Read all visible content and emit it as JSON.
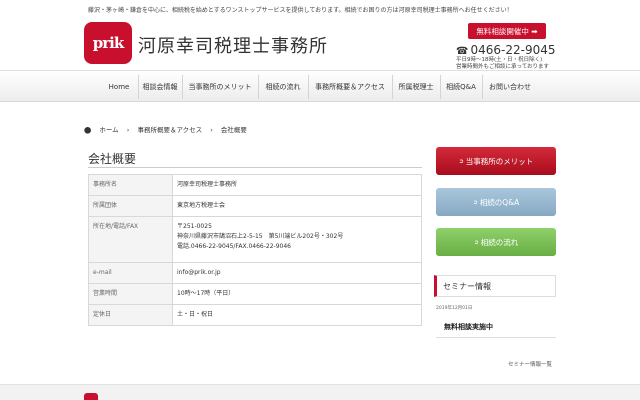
{
  "header": {
    "tagline": "藤沢・茅ヶ崎・鎌倉を中心に、相続税を始めとするワンストップサービスを提供しております。相続でお困りの方は河原幸司税理士事務所へお任せください！",
    "logo_text": "prik",
    "office_name": "河原幸司税理士事務所",
    "consult_button": "無料相談開催中 ➡",
    "phone": "0466-22-9045",
    "hours_line1": "平日9時〜18時(土・日・祝日除く)",
    "hours_line2": "営業時間外もご相談に承っております"
  },
  "nav": {
    "items": [
      {
        "label": "Home"
      },
      {
        "label": "相談会情報"
      },
      {
        "label": "当事務所のメリット"
      },
      {
        "label": "相続の流れ"
      },
      {
        "label": "事務所概要＆アクセス"
      },
      {
        "label": "所属税理士"
      },
      {
        "label": "相続Q&A"
      },
      {
        "label": "お問い合わせ"
      }
    ]
  },
  "breadcrumb": {
    "home": "ホーム",
    "section": "事務所概要＆アクセス",
    "current": "会社概要"
  },
  "main": {
    "title": "会社概要",
    "rows": [
      {
        "label": "事務所名",
        "value": "河原幸司税理士事務所"
      },
      {
        "label": "所属団体",
        "value": "東京地方税理士会"
      },
      {
        "label": "所在地/電話/FAX",
        "lines": [
          "〒251-0025",
          "神奈川県藤沢市鵠沼石上2-5-15　第5川端ビル202号・302号",
          "電話.0466-22-9045/FAX.0466-22-9046"
        ]
      },
      {
        "label": "e-mail",
        "value": "info@prik.or.jp"
      },
      {
        "label": "営業時間",
        "value": "10時〜17時（平日）"
      },
      {
        "label": "定休日",
        "value": "土・日・祝日"
      }
    ]
  },
  "sidebar": {
    "merit_button": "当事務所のメリット",
    "qa_button": "相続のQ&A",
    "flow_button": "相続の流れ",
    "seminar_heading": "セミナー情報",
    "seminar_date": "2019年12月01日",
    "seminar_title": "無料相談実施中",
    "seminar_more": "セミナー情報一覧"
  },
  "colors": {
    "brand_red": "#c8102e",
    "blue_button": "#97b8cf",
    "green_button": "#7cc258"
  }
}
